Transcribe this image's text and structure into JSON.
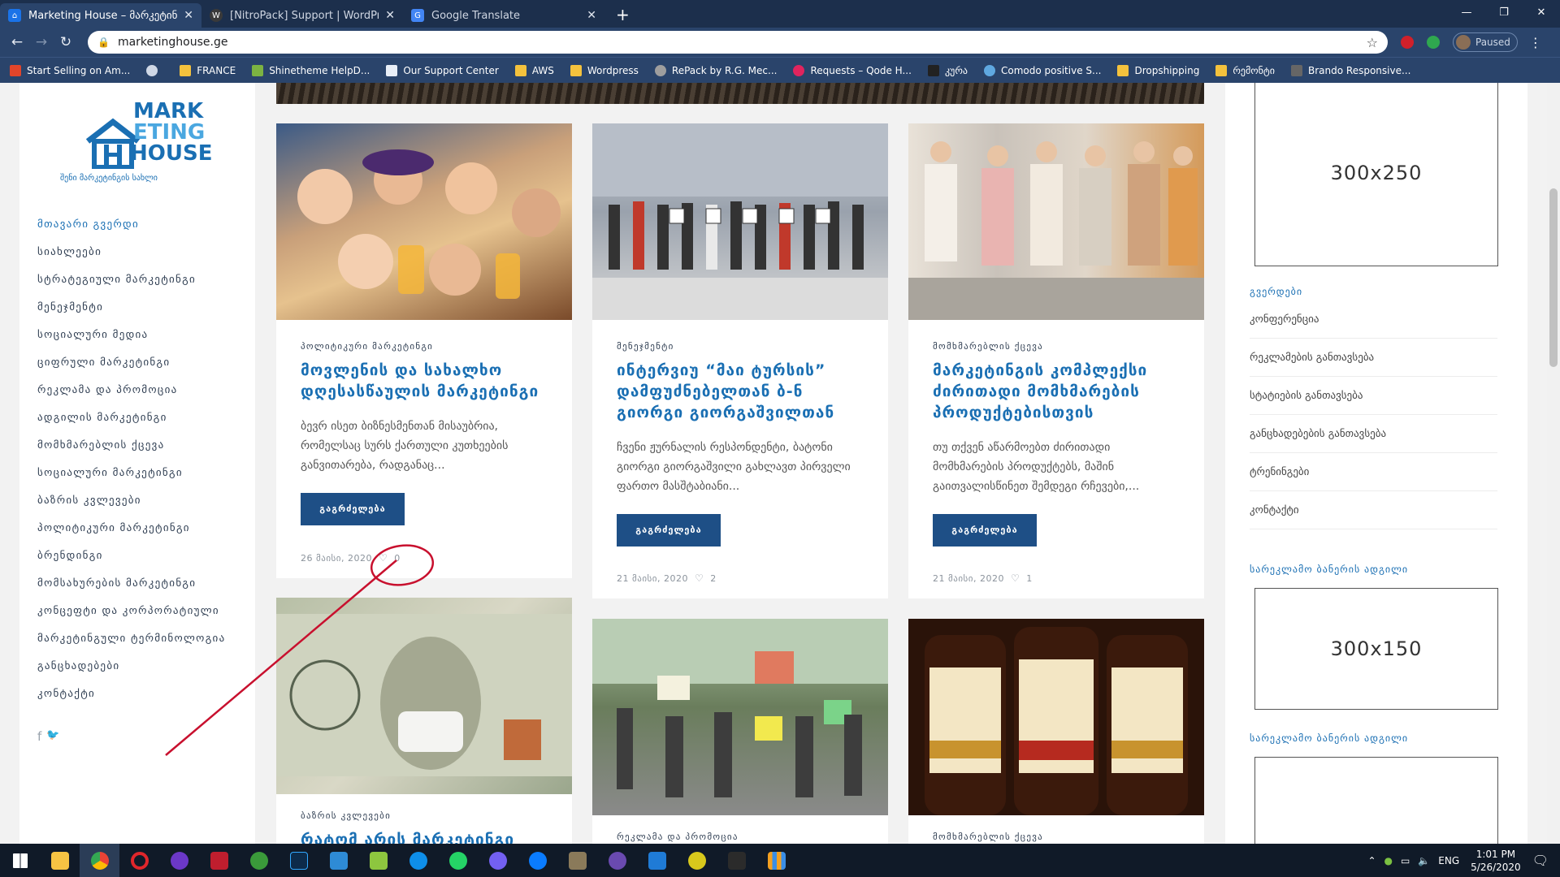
{
  "browser": {
    "tabs": [
      {
        "title": "Marketing House – მარკეტინგის სახლი",
        "favicon_color": "#1a73e8",
        "active": true
      },
      {
        "title": "[NitroPack] Support | WordPress.org",
        "favicon_color": "#3a3a3a",
        "active": false
      },
      {
        "title": "Google Translate",
        "favicon_color": "#4285f4",
        "active": false
      }
    ],
    "new_tab": "+",
    "url": "marketinghouse.ge",
    "profile_label": "Paused",
    "bookmarks": [
      {
        "label": "Start Selling on Am...",
        "icon": "amazon-icon"
      },
      {
        "label": "",
        "icon": "globe-icon"
      },
      {
        "label": "FRANCE",
        "icon": "folder-icon"
      },
      {
        "label": "Shinetheme HelpD...",
        "icon": "shinetheme-icon"
      },
      {
        "label": "Our Support Center",
        "icon": "support-icon"
      },
      {
        "label": "AWS",
        "icon": "folder-icon"
      },
      {
        "label": "Wordpress",
        "icon": "folder-icon"
      },
      {
        "label": "RePack by R.G. Mec...",
        "icon": "repack-icon"
      },
      {
        "label": "Requests – Qode H...",
        "icon": "qode-icon"
      },
      {
        "label": "კურა",
        "icon": "kura-icon"
      },
      {
        "label": "Comodo positive S...",
        "icon": "comodo-icon"
      },
      {
        "label": "Dropshipping",
        "icon": "folder-icon"
      },
      {
        "label": "რემონტი",
        "icon": "folder-icon"
      },
      {
        "label": "Brando Responsive...",
        "icon": "brando-icon"
      }
    ]
  },
  "site": {
    "logo": {
      "line1": "MARK",
      "line2": "ETING",
      "line3": "HOUSE",
      "tagline": "შენი მარკეტინგის სახლი"
    },
    "menu": [
      "მთავარი გვერდი",
      "სიახლეები",
      "სტრატეგიული მარკეტინგი",
      "მენეჯმენტი",
      "სოციალური მედია",
      "ციფრული მარკეტინგი",
      "რეკლამა და პრომოცია",
      "ადგილის მარკეტინგი",
      "მომხმარებლის ქცევა",
      "სოციალური მარკეტინგი",
      "ბაზრის კვლევები",
      "პოლიტიკური მარკეტინგი",
      "ბრენდინგი",
      "მომსახურების მარკეტინგი",
      "კონცეფტი და კორპორატიული",
      "მარკეტინგული ტერმინოლოგია",
      "განცხადებები",
      "კონტაქტი"
    ],
    "social": {
      "facebook": "f",
      "twitter": "🐦"
    }
  },
  "posts": [
    {
      "category": "პოლიტიკური მარკეტინგი",
      "title": "მოვლენის და სახალხო დღესასწაულის მარკეტინგი",
      "excerpt": "ბევრ ისეთ ბიზნესმენთან მისაუბრია, რომელსაც სურს ქართული კუთხეების განვითარება, რადგანაც...",
      "button": "გაგრძელება",
      "date": "26 მაისი, 2020",
      "likes": "0"
    },
    {
      "category": "მენეჯმენტი",
      "title": "ინტერვიუ “მაი ტურსის” დამფუძნებელთან ბ-ნ გიორგი გიორგაშვილთან",
      "excerpt": "ჩვენი ჟურნალის რესპონდენტი, ბატონი გიორგი გიორგაშვილი გახლავთ პირველი ფართო მასშტაბიანი...",
      "button": "გაგრძელება",
      "date": "21 მაისი, 2020",
      "likes": "2"
    },
    {
      "category": "მომხმარებლის ქცევა",
      "title": "მარკეტინგის კომპლექსი ძირითადი მომხმარების პროდუქტებისთვის",
      "excerpt": "თუ თქვენ აწარმოებთ ძირითადი მომხმარების პროდუქტებს, მაშინ გაითვალისწინეთ შემდეგი რჩევები,...",
      "button": "გაგრძელება",
      "date": "21 მაისი, 2020",
      "likes": "1"
    }
  ],
  "posts_row2": [
    {
      "category": "ბაზრის კვლევები",
      "title": "რატომ არის მარკეტინგი"
    },
    {
      "category": "რეკლამა და პრომოცია",
      "title": ""
    },
    {
      "category": "მომხმარებლის ქცევა",
      "title": ""
    }
  ],
  "rightbar": {
    "ad1": "300x250",
    "pages_title": "გვერდები",
    "pages": [
      "კონფერენცია",
      "რეკლამების განთავსება",
      "სტატიების განთავსება",
      "განცხადებების განთავსება",
      "ტრენინგები",
      "კონტაქტი"
    ],
    "ad_title_1": "სარეკლამო ბანერის ადგილი",
    "ad2": "300x150",
    "ad_title_2": "სარეკლამო ბანერის ადგილი"
  },
  "taskbar": {
    "lang": "ENG",
    "time": "1:01 PM",
    "date": "5/26/2020"
  },
  "colors": {
    "accent": "#1a6fb3",
    "button": "#1e4f86",
    "chrome": "#2a446b",
    "annotation": "#c8102e"
  }
}
